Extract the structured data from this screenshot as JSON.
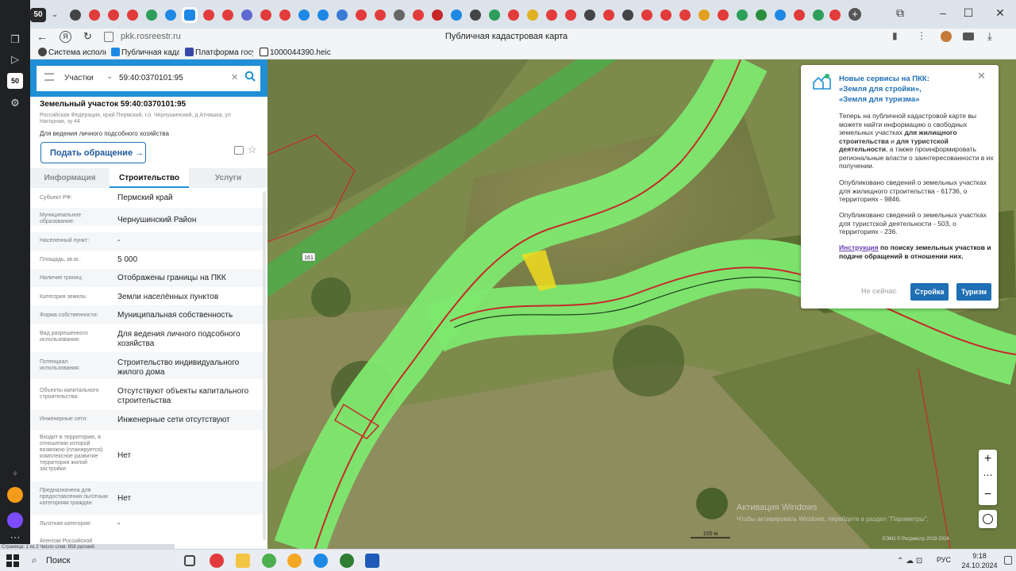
{
  "browser": {
    "tab_badge": "50",
    "url": "pkk.rosreestr.ru",
    "page_title": "Публичная кадастровая карта",
    "bookmarks": [
      {
        "label": "Система исполне",
        "color": "#444"
      },
      {
        "label": "Публичная кадас",
        "color": "#1e88e5"
      },
      {
        "label": "Платформа госуд",
        "color": "#3949ab"
      },
      {
        "label": "1000044390.heic",
        "color": "#222"
      }
    ],
    "sidebar_badge": "50"
  },
  "search": {
    "type_label": "Участки",
    "query": "59:40:0370101:95"
  },
  "parcel": {
    "title": "Земельный участок 59:40:0370101:95",
    "address": "Российская Федерация, край Пермский, г.о. Чернушинский, д.Атняшка, ул Нагорная, зу 44",
    "use": "Для ведения личного подсобного хозяйства",
    "appeal_button": "Подать обращение",
    "tabs": [
      "Информация",
      "Строительство",
      "Услуги"
    ],
    "active_tab": 1,
    "rows": [
      {
        "label": "Субъект РФ:",
        "value": "Пермский край"
      },
      {
        "label": "Муниципальное образование:",
        "value": "Чернушинский Район"
      },
      {
        "label": "Населенный пункт:",
        "value": "-"
      },
      {
        "label": "Площадь, кв.м.:",
        "value": "5 000"
      },
      {
        "label": "Наличие границ:",
        "value": "Отображены границы на ПКК"
      },
      {
        "label": "Категория земель:",
        "value": "Земли населённых пунктов"
      },
      {
        "label": "Форма собственности:",
        "value": "Муниципальная собственность"
      },
      {
        "label": "Вид разрешенного использования:",
        "value": "Для ведения личного подсобного хозяйства"
      },
      {
        "label": "Потенциал использования:",
        "value": "Строительство индивидуального жилого дома"
      },
      {
        "label": "Объекты капитального строительства:",
        "value": "Отсутствуют объекты капитального строительства"
      },
      {
        "label": "Инженерные сети:",
        "value": "Инженерные сети отсутствуют"
      },
      {
        "label": "Входит в территорию, в отношении которой возможно (планируется) комплексное развитие территории жилой застройки:",
        "value": "Нет"
      },
      {
        "label": "Предназначена для предоставления льготным категориям граждан:",
        "value": "Нет"
      },
      {
        "label": "Льготная категория:",
        "value": "-"
      },
      {
        "label": "Агентом Российской",
        "value": ""
      }
    ]
  },
  "popup": {
    "title_1": "Новые сервисы на ПКК:",
    "title_2": "«Земля для стройки»,",
    "title_3": "«Земля для туризма»",
    "p1_a": "Теперь на публичной кадастровой карте вы можете найти информацию о свободных земельных участках",
    "p1_b": "для жилищного строительства",
    "p1_c": "и",
    "p1_d": "для туристской деятельности",
    "p1_e": ", а также проинформировать региональные власти о заинтересованности в их получении.",
    "p2": "Опубликовано сведений о земельных участках для жилищного строительства - 61736, о территориях - 9846.",
    "p3": "Опубликовано сведений о земельных участках для туристской деятельности - 503, о территориях - 236.",
    "p4_link": "Инструкция",
    "p4_rest": " по поиску земельных участков и подаче обращений в отношении них.",
    "btn_later": "Не сейчас",
    "btn_build": "Стройка",
    "btn_tourism": "Туризм"
  },
  "map": {
    "road_label": "161",
    "scale_label": "100 м",
    "attribution": "ЕЭКО © Росреестр 2019-2024",
    "watermark_1": "Активация Windows",
    "watermark_2": "Чтобы активировать Windows, перейдите в раздел \"Параметры\"."
  },
  "statusbar": {
    "left": "Страница: 1 из 2   Число слов: 658   русский"
  },
  "taskbar": {
    "search": "Поиск",
    "lang": "РУС",
    "time": "9:18",
    "date": "24.10.2024"
  }
}
